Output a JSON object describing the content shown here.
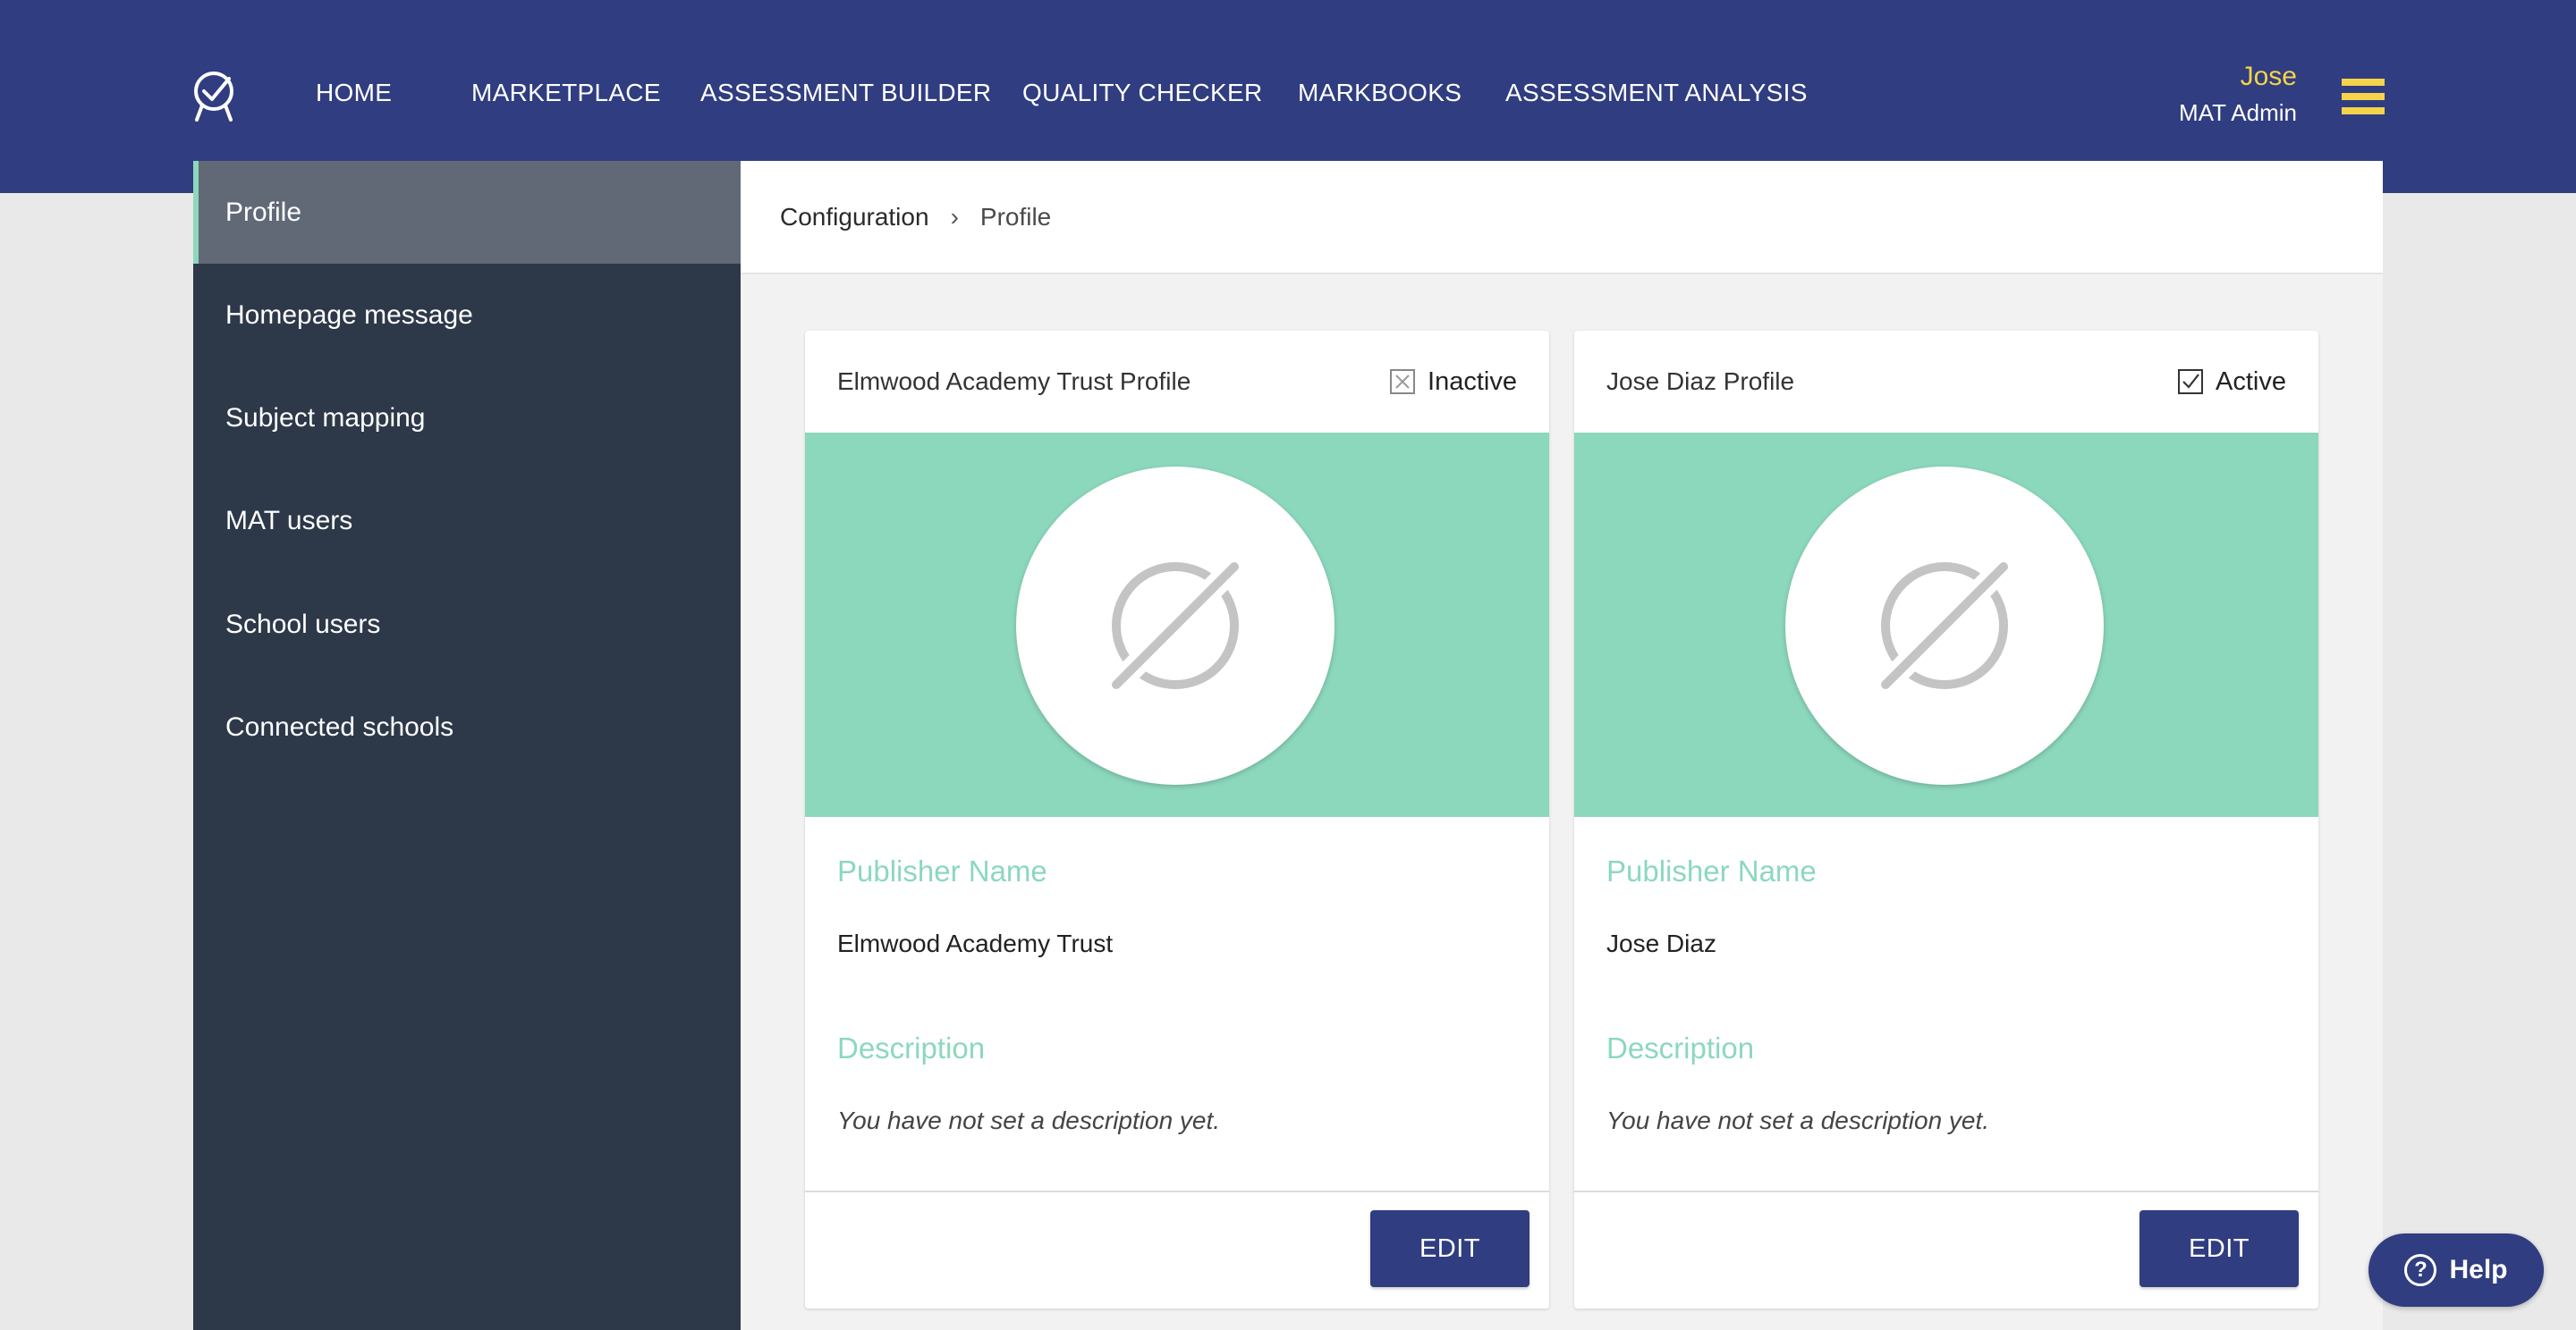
{
  "nav": {
    "items": [
      "HOME",
      "MARKETPLACE",
      "ASSESSMENT BUILDER",
      "QUALITY CHECKER",
      "MARKBOOKS",
      "ASSESSMENT ANALYSIS"
    ]
  },
  "user": {
    "name": "Jose",
    "role": "MAT Admin"
  },
  "sidebar": {
    "items": [
      {
        "label": "Profile",
        "active": true
      },
      {
        "label": "Homepage message"
      },
      {
        "label": "Subject mapping"
      },
      {
        "label": "MAT users"
      },
      {
        "label": "School users"
      },
      {
        "label": "Connected schools"
      }
    ]
  },
  "breadcrumb": {
    "parent": "Configuration",
    "separator": "›",
    "current": "Profile"
  },
  "cards": [
    {
      "title": "Elmwood Academy Trust Profile",
      "status": "Inactive",
      "publisher_label": "Publisher Name",
      "publisher_name": "Elmwood Academy Trust",
      "description_label": "Description",
      "description": "You have not set a description yet.",
      "edit_label": "EDIT"
    },
    {
      "title": "Jose Diaz Profile",
      "status": "Active",
      "publisher_label": "Publisher Name",
      "publisher_name": "Jose Diaz",
      "description_label": "Description",
      "description": "You have not set a description yet.",
      "edit_label": "EDIT"
    }
  ],
  "help": {
    "label": "Help",
    "icon": "?"
  },
  "colors": {
    "header": "#303d80",
    "accent_yellow": "#f5d34a",
    "sidebar": "#2d3849",
    "sidebar_active": "#616977",
    "mint": "#8cd8bc"
  }
}
